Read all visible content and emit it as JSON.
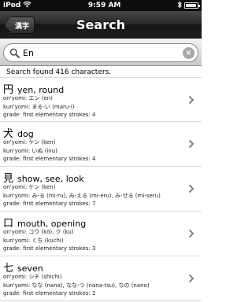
{
  "status_bar": {
    "carrier": "iPod",
    "time": "9:59 AM",
    "wifi_icon": "wifi-icon",
    "bluetooth_icon": "bluetooth-icon",
    "battery_icon": "battery-icon",
    "battery_level": 0.95
  },
  "nav": {
    "back_label": "漢字",
    "title": "Search"
  },
  "search": {
    "value": "En",
    "clear_icon": "clear-icon"
  },
  "result_count": "Search found 416 characters.",
  "results": [
    {
      "kanji": "円",
      "meaning": "yen, round",
      "onyomi": "on'yomi: エン (en)",
      "kunyomi": "kun'yomi: まる-い (maru-i)",
      "grade": "grade: first elementary   strokes: 4"
    },
    {
      "kanji": "犬",
      "meaning": "dog",
      "onyomi": "on'yomi: ケン (ken)",
      "kunyomi": "kun'yomi: いぬ (inu)",
      "grade": "grade: first elementary   strokes: 4"
    },
    {
      "kanji": "見",
      "meaning": "show, see, look",
      "onyomi": "on'yomi: ケン (ken)",
      "kunyomi": "kun'yomi: み-る (mi-ru), み-える (mi-eru), み-せる (mi-seru)",
      "grade": "grade: first elementary   strokes: 7"
    },
    {
      "kanji": "口",
      "meaning": "mouth, opening",
      "onyomi": "on'yomi: コウ (kō), ク (ku)",
      "kunyomi": "kun'yomi: くち (kuchi)",
      "grade": "grade: first elementary   strokes: 3"
    },
    {
      "kanji": "七",
      "meaning": "seven",
      "onyomi": "on'yomi: シチ (shichi)",
      "kunyomi": "kun'yomi: なな (nana), なな-つ (nana-tsu), なの (nano)",
      "grade": "grade: first elementary   strokes: 2"
    }
  ]
}
